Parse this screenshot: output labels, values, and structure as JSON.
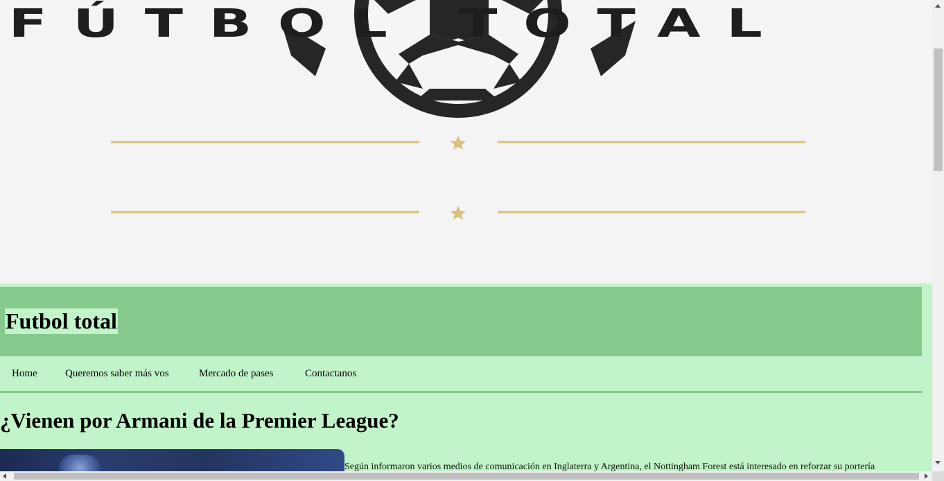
{
  "hero": {
    "logo_text": "FÚTBOL TOTAL"
  },
  "header": {
    "site_title": "Futbol total"
  },
  "nav": {
    "items": [
      {
        "label": "Home"
      },
      {
        "label": "Queremos saber más vos"
      },
      {
        "label": "Mercado de pases"
      },
      {
        "label": "Contactanos"
      }
    ]
  },
  "article": {
    "title": "¿Vienen por Armani de la Premier League?",
    "text": "Según informaron varios medios de comunicación en Inglaterra y Argentina, el Nottingham Forest está interesado en reforzar su portería"
  },
  "colors": {
    "page_background": "#c1f4c8",
    "header_band": "#85c98c",
    "hero_background": "#f4f4f4",
    "logo_gold": "#dcbf7a",
    "logo_dark": "#1e1e1e"
  },
  "icons": {
    "ball": "soccer-ball-icon",
    "star": "star-icon"
  }
}
